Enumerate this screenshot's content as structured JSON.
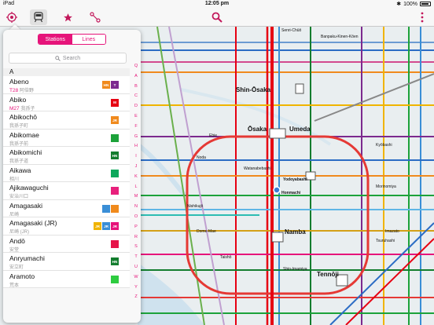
{
  "status": {
    "carrier": "iPad",
    "time": "12:05 pm",
    "battery": "100%"
  },
  "nav": {
    "icons": [
      "location-icon",
      "train-icon",
      "star-icon",
      "route-icon",
      "search-icon"
    ]
  },
  "popover": {
    "tabs": {
      "stations": "Stations",
      "lines": "Lines"
    },
    "search_placeholder": "Search",
    "section": "A",
    "index_letters": [
      "Q",
      "A",
      "B",
      "C",
      "D",
      "E",
      "F",
      "G",
      "H",
      "I",
      "J",
      "K",
      "L",
      "M",
      "N",
      "O",
      "P",
      "R",
      "S",
      "T",
      "U",
      "W",
      "Y",
      "Z"
    ],
    "stations": [
      {
        "name": "Abeno",
        "code": "T28",
        "kana": "阿倍野",
        "badges": [
          {
            "t": "HN",
            "c": "#f08a1d"
          },
          {
            "t": "T",
            "c": "#7c2a8e"
          }
        ]
      },
      {
        "name": "Abiko",
        "code": "M27",
        "kana": "我孫子",
        "badges": [
          {
            "t": "M",
            "c": "#e60012"
          }
        ]
      },
      {
        "name": "Abikochō",
        "code": "",
        "kana": "我孫子町",
        "badges": [
          {
            "t": "JR",
            "c": "#f08a1d"
          }
        ]
      },
      {
        "name": "Abikomae",
        "code": "",
        "kana": "我孫子前",
        "badges": [
          {
            "t": "",
            "c": "#1ca23a"
          }
        ]
      },
      {
        "name": "Abikomichi",
        "code": "",
        "kana": "我孫子道",
        "badges": [
          {
            "t": "HN",
            "c": "#137d2e"
          }
        ]
      },
      {
        "name": "Aikawa",
        "code": "",
        "kana": "相川",
        "badges": [
          {
            "t": "",
            "c": "#0ea85c"
          }
        ]
      },
      {
        "name": "Ajikawaguchi",
        "code": "",
        "kana": "安治川口",
        "badges": [
          {
            "t": "",
            "c": "#e8207c"
          }
        ]
      },
      {
        "name": "Amagasaki",
        "code": "",
        "kana": "尼崎",
        "badges": [
          {
            "t": "",
            "c": "#3a8ed6"
          },
          {
            "t": "",
            "c": "#f08a1d"
          }
        ]
      },
      {
        "name": "Amagasaki (JR)",
        "code": "",
        "kana": "尼崎 (JR)",
        "badges": [
          {
            "t": "JR",
            "c": "#f0b400"
          },
          {
            "t": "JR",
            "c": "#3a8ed6"
          },
          {
            "t": "JR",
            "c": "#e6147a"
          }
        ]
      },
      {
        "name": "Andō",
        "code": "",
        "kana": "安堂",
        "badges": [
          {
            "t": "",
            "c": "#e6144a"
          }
        ]
      },
      {
        "name": "Anryumachi",
        "code": "",
        "kana": "安立町",
        "badges": [
          {
            "t": "HN",
            "c": "#137d2e"
          }
        ]
      },
      {
        "name": "Aramoto",
        "code": "",
        "kana": "荒本",
        "badges": [
          {
            "t": "",
            "c": "#2ecc40"
          }
        ]
      }
    ]
  },
  "map": {
    "stations_major": [
      "Shin-Ōsaka",
      "Ōsaka",
      "Umeda",
      "Namba",
      "Tennōji",
      "Yodoyabashi",
      "Honmachi"
    ],
    "stations_minor": [
      "Senri-Chūō",
      "Banpaku-Kinen-Kōen",
      "Ebie",
      "Noda",
      "Nishikujō",
      "Dome-Mae",
      "Taishō",
      "Kyōbashi",
      "Morinomiya",
      "Tsuruhashi",
      "Imazato",
      "Watanabebashi",
      "Shin-Imamiya"
    ],
    "colors": {
      "loop": "#e6147a",
      "jr_red": "#e53935",
      "midosuji": "#e60012",
      "water": "#cfe2ee"
    }
  }
}
